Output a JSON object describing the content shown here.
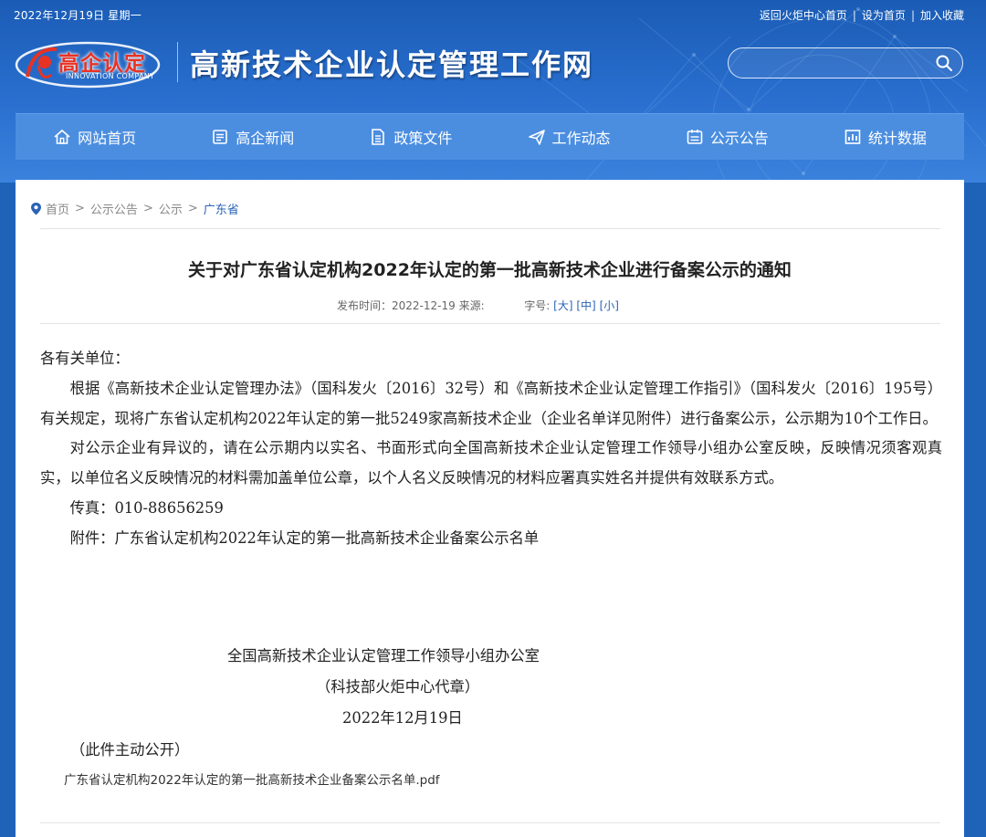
{
  "topbar": {
    "date": "2022年12月19日 星期一",
    "links": [
      "返回火炬中心首页",
      "设为首页",
      "加入收藏"
    ],
    "separator": "|"
  },
  "logo": {
    "cn": "高企认定",
    "en": "INNOVATION COMPANY"
  },
  "site_title": "高新技术企业认定管理工作网",
  "search": {
    "placeholder": "",
    "icon": "search-icon"
  },
  "nav": [
    {
      "label": "网站首页",
      "icon": "home-icon"
    },
    {
      "label": "高企新闻",
      "icon": "news-icon"
    },
    {
      "label": "政策文件",
      "icon": "document-icon"
    },
    {
      "label": "工作动态",
      "icon": "paper-plane-icon"
    },
    {
      "label": "公示公告",
      "icon": "announcement-icon"
    },
    {
      "label": "统计数据",
      "icon": "chart-icon"
    }
  ],
  "breadcrumb": {
    "items": [
      "首页",
      "公示公告",
      "公示",
      "广东省"
    ],
    "separator": ">"
  },
  "article": {
    "title": "关于对广东省认定机构2022年认定的第一批高新技术企业进行备案公示的通知",
    "meta": {
      "publish_label": "发布时间：",
      "publish_date": "2022-12-19",
      "source_label": "来源:",
      "font_label": "字号:",
      "font_large": "[大]",
      "font_medium": "[中]",
      "font_small": "[小]"
    },
    "salutation": "各有关单位：",
    "paragraph1": "根据《高新技术企业认定管理办法》（国科发火〔2016〕32号）和《高新技术企业认定管理工作指引》（国科发火〔2016〕195号）有关规定，现将广东省认定机构2022年认定的第一批5249家高新技术企业（企业名单详见附件）进行备案公示，公示期为10个工作日。",
    "paragraph2": "对公示企业有异议的，请在公示期内以实名、书面形式向全国高新技术企业认定管理工作领导小组办公室反映，反映情况须客观真实，以单位名义反映情况的材料需加盖单位公章，以个人名义反映情况的材料应署真实姓名并提供有效联系方式。",
    "fax": "传真：010-88656259",
    "attachment_line": "附件：广东省认定机构2022年认定的第一批高新技术企业备案公示名单",
    "signature_org": "全国高新技术企业认定管理工作领导小组办公室",
    "signature_proxy": "（科技部火炬中心代章）",
    "signature_date": "2022年12月19日",
    "disclosure": "（此件主动公开）",
    "attachment_file": "广东省认定机构2022年认定的第一批高新技术企业备案公示名单.pdf"
  },
  "colors": {
    "header_blue": "#1f63b9",
    "nav_blue": "#4b8ee0",
    "link_blue": "#2a63b7",
    "logo_red": "#e83224"
  }
}
